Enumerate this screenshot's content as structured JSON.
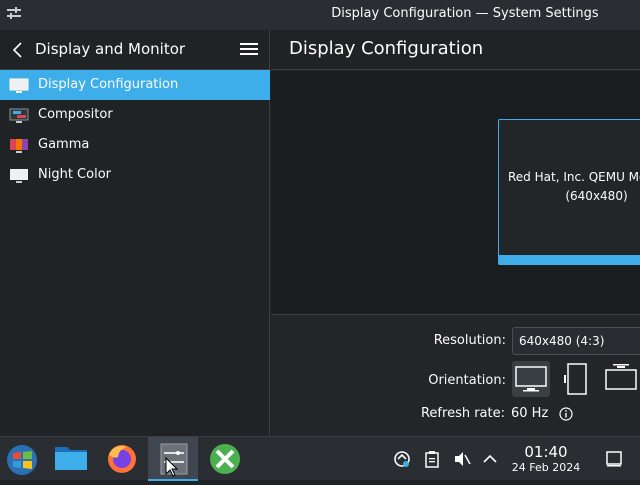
{
  "window": {
    "title": "Display Configuration — System Settings"
  },
  "sidebar": {
    "title": "Display and Monitor",
    "items": [
      {
        "label": "Display Configuration",
        "icon": "display-icon",
        "selected": true
      },
      {
        "label": "Compositor",
        "icon": "compositor-icon"
      },
      {
        "label": "Gamma",
        "icon": "gamma-icon"
      },
      {
        "label": "Night Color",
        "icon": "night-color-icon"
      }
    ]
  },
  "main": {
    "title": "Display Configuration",
    "monitor": {
      "name": "Red Hat, Inc. QEMU Monitor",
      "resolution": "(640x480)"
    },
    "resolution_label": "Resolution:",
    "resolution_value": "640x480 (4:3)",
    "orientation_label": "Orientation:",
    "refresh_label": "Refresh rate:",
    "refresh_value": "60 Hz"
  },
  "taskbar": {
    "time": "01:40",
    "date": "24 Feb 2024"
  },
  "colors": {
    "accent": "#3daee9",
    "window_bg": "#202326",
    "panel_bg": "#2a2e32"
  }
}
